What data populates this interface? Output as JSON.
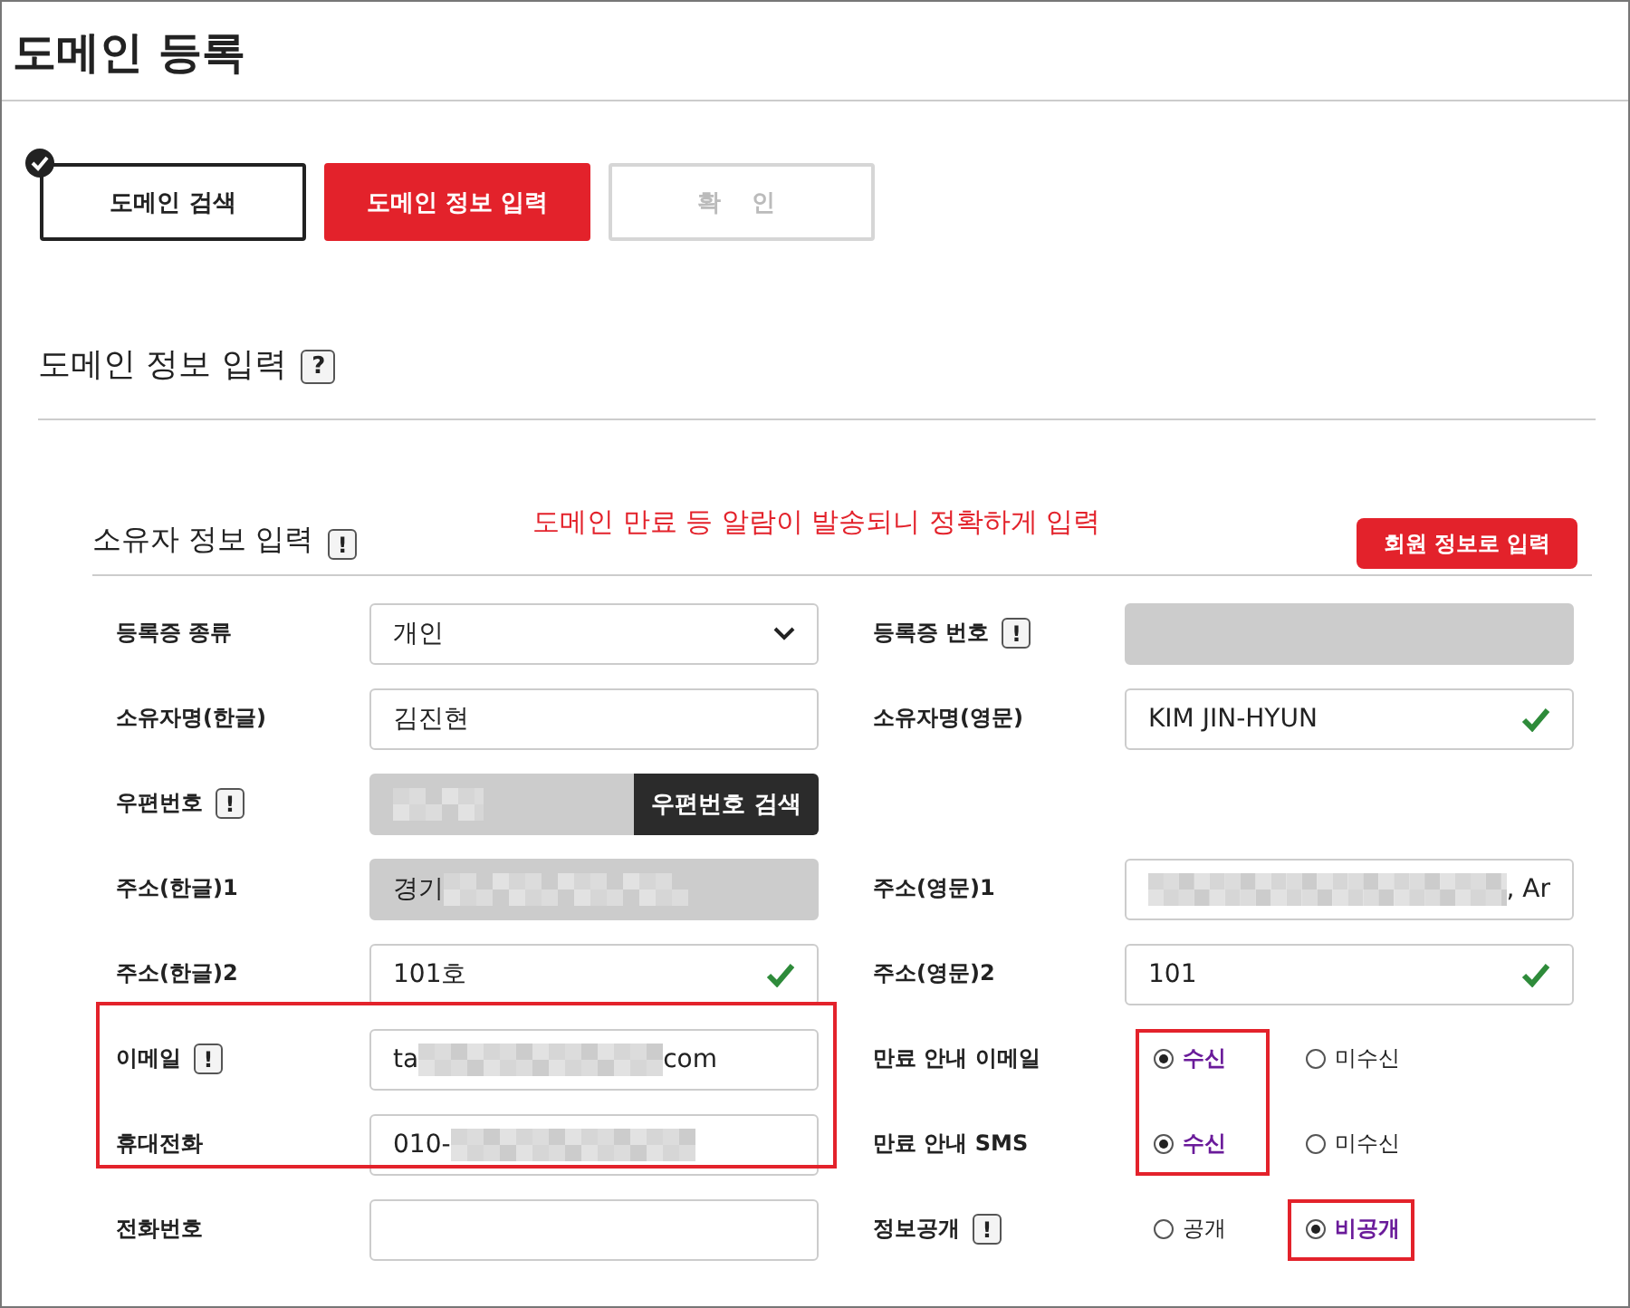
{
  "title": "도메인 등록",
  "steps": [
    {
      "label": "도메인 검색",
      "done": true,
      "selected": false
    },
    {
      "label": "도메인 정보 입력",
      "done": false,
      "selected": true
    },
    {
      "label": "확 인",
      "done": false,
      "selected": false
    }
  ],
  "section": {
    "title": "도메인 정보 입력",
    "help": "?"
  },
  "owner": {
    "title": "소유자 정보 입력",
    "help": "!",
    "notice": "도메인 만료 등 알람이 발송되니 정확하게 입력",
    "fill_button": "회원 정보로 입력"
  },
  "left": [
    {
      "label": "등록증 종류",
      "field": {
        "kind": "select",
        "parts": [
          {
            "kind": "text",
            "text": "개인"
          }
        ]
      }
    },
    {
      "label": "소유자명(한글)",
      "field": {
        "kind": "text",
        "valid": false,
        "parts": [
          {
            "kind": "text",
            "text": "김진현"
          }
        ]
      }
    },
    {
      "label": "우편번호",
      "help": "!",
      "field": {
        "kind": "postcode",
        "button": "우편번호 검색",
        "parts": [
          {
            "kind": "redacted"
          }
        ]
      }
    },
    {
      "label": "주소(한글)1",
      "field": {
        "kind": "readonly",
        "parts": [
          {
            "kind": "text",
            "text": "경기"
          },
          {
            "kind": "redacted"
          }
        ]
      }
    },
    {
      "label": "주소(한글)2",
      "field": {
        "kind": "text",
        "valid": true,
        "parts": [
          {
            "kind": "text",
            "text": "101호"
          }
        ]
      }
    },
    {
      "label": "이메일",
      "help": "!",
      "highlight": true,
      "field": {
        "kind": "text",
        "valid": false,
        "parts": [
          {
            "kind": "text",
            "text": "ta"
          },
          {
            "kind": "redacted"
          },
          {
            "kind": "text",
            "text": "com"
          }
        ]
      }
    },
    {
      "label": "휴대전화",
      "highlight": true,
      "field": {
        "kind": "text",
        "valid": false,
        "parts": [
          {
            "kind": "text",
            "text": "010-"
          },
          {
            "kind": "redacted"
          }
        ]
      }
    },
    {
      "label": "전화번호",
      "field": {
        "kind": "text",
        "valid": false
      }
    }
  ],
  "right": [
    {
      "label": "등록증 번호",
      "help": "!",
      "field": {
        "kind": "readonly"
      }
    },
    {
      "label": "소유자명(영문)",
      "field": {
        "kind": "text",
        "valid": true,
        "parts": [
          {
            "kind": "text",
            "text": "KIM JIN-HYUN"
          }
        ]
      }
    },
    {
      "field": {
        "kind": "blank"
      }
    },
    {
      "label": "주소(영문)1",
      "field": {
        "kind": "text",
        "valid": false,
        "parts": [
          {
            "kind": "redacted"
          },
          {
            "kind": "text",
            "text": ", Ar"
          }
        ]
      }
    },
    {
      "label": "주소(영문)2",
      "field": {
        "kind": "text",
        "valid": true,
        "parts": [
          {
            "kind": "text",
            "text": "101"
          }
        ]
      }
    },
    {
      "label": "만료 안내 이메일",
      "field": {
        "kind": "radio",
        "options": [
          {
            "label": "수신",
            "selected": true,
            "highlight": true
          },
          {
            "label": "미수신",
            "selected": false,
            "highlight": false
          }
        ]
      }
    },
    {
      "label": "만료 안내 SMS",
      "field": {
        "kind": "radio",
        "options": [
          {
            "label": "수신",
            "selected": true,
            "highlight": true
          },
          {
            "label": "미수신",
            "selected": false,
            "highlight": false
          }
        ]
      }
    },
    {
      "label": "정보공개",
      "help": "!",
      "field": {
        "kind": "radio",
        "options": [
          {
            "label": "공개",
            "selected": false,
            "highlight": false
          },
          {
            "label": "비공개",
            "selected": true,
            "highlight": true
          }
        ]
      }
    }
  ]
}
